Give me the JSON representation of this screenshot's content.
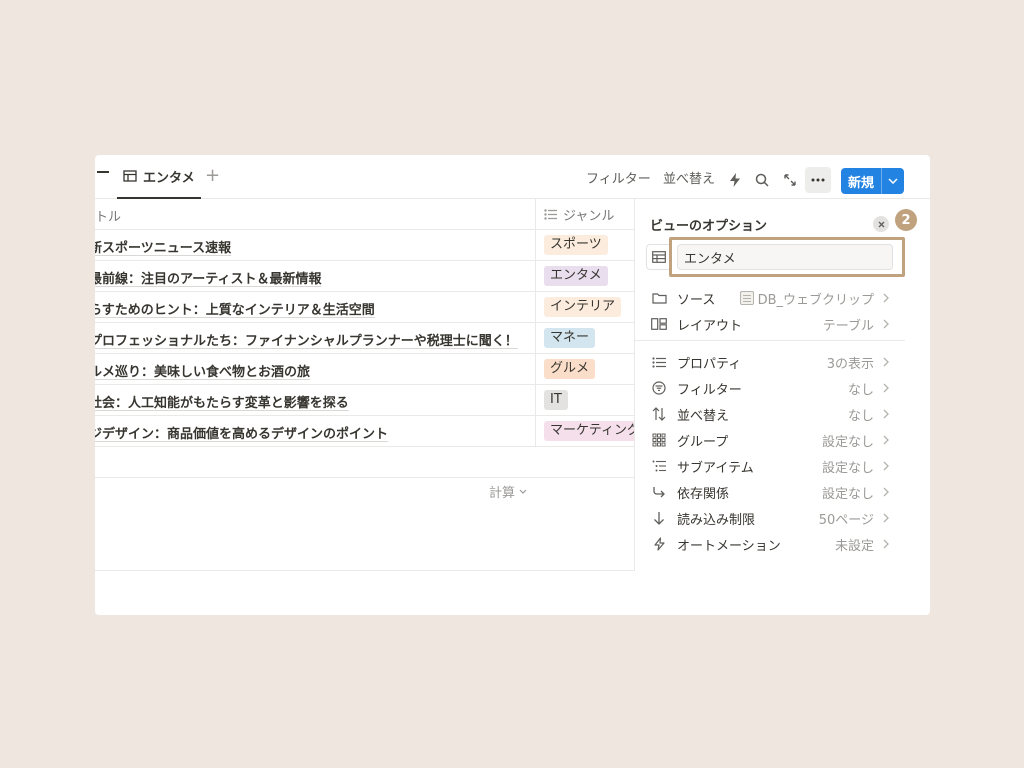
{
  "toolbar": {
    "tab_label": "エンタメ",
    "add_tab": "+",
    "filter_label": "フィルター",
    "sort_label": "並べ替え",
    "new_label": "新規"
  },
  "table": {
    "title_header": "トル",
    "genre_header": "ジャンル",
    "rows": [
      {
        "title": "新スポーツニュース速報",
        "genre": "スポーツ",
        "tag_color": "#fbecdd"
      },
      {
        "title": "最前線：注目のアーティスト＆最新情報",
        "genre": "エンタメ",
        "tag_color": "#e8deee"
      },
      {
        "title": "らすためのヒント：上質なインテリア＆生活空間",
        "genre": "インテリア",
        "tag_color": "#fbecdd"
      },
      {
        "title": "プロフェッショナルたち：ファイナンシャルプランナーや税理士に聞く！",
        "genre": "マネー",
        "tag_color": "#d3e5ef"
      },
      {
        "title": "ルメ巡り：美味しい食べ物とお酒の旅",
        "genre": "グルメ",
        "tag_color": "#fadec9"
      },
      {
        "title": "社会：人工知能がもたらす変革と影響を探る",
        "genre": "IT",
        "tag_color": "#e3e2e0"
      },
      {
        "title": "ジデザイン：商品価値を高めるデザインのポイント",
        "genre": "マーケティング",
        "tag_color": "#f4dfeb"
      }
    ],
    "calc_label": "計算"
  },
  "panel": {
    "title": "ビューのオプション",
    "badge": "2",
    "view_name": "エンタメ",
    "options": [
      {
        "icon": "folder-icon",
        "label": "ソース",
        "value": "DB_ウェブクリップ"
      },
      {
        "icon": "layout-icon",
        "label": "レイアウト",
        "value": "テーブル"
      },
      {
        "icon": "list-icon",
        "label": "プロパティ",
        "value": "3の表示"
      },
      {
        "icon": "filter-icon",
        "label": "フィルター",
        "value": "なし"
      },
      {
        "icon": "sort-icon",
        "label": "並べ替え",
        "value": "なし"
      },
      {
        "icon": "group-icon",
        "label": "グループ",
        "value": "設定なし"
      },
      {
        "icon": "subitem-icon",
        "label": "サブアイテム",
        "value": "設定なし"
      },
      {
        "icon": "dependency-icon",
        "label": "依存関係",
        "value": "設定なし"
      },
      {
        "icon": "load-limit-icon",
        "label": "読み込み制限",
        "value": "50ページ"
      },
      {
        "icon": "automation-icon",
        "label": "オートメーション",
        "value": "未設定"
      }
    ]
  },
  "colors": {
    "background": "#efe6df",
    "accent": "#2383e2",
    "highlight": "#c0a27f"
  }
}
